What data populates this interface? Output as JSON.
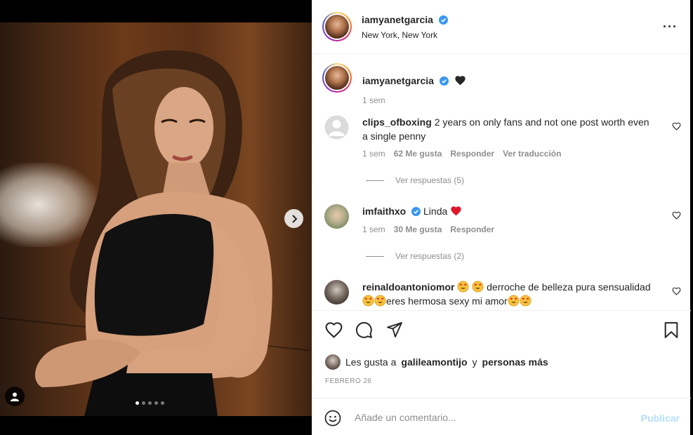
{
  "post": {
    "username": "iamyanetgarcia",
    "location": "New York, New York",
    "caption_emoji": "black-heart",
    "time_ago": "1 sem"
  },
  "media": {
    "total_slides": 5,
    "active_slide": 1
  },
  "comments": [
    {
      "username": "clips_ofboxing",
      "text": "2 years on only fans and not one post worth even a single penny",
      "time": "1 sem",
      "likes": "62 Me gusta",
      "reply": "Responder",
      "translate": "Ver traducción",
      "replies": "Ver respuestas (5)",
      "avatar": "default-avatar-icon"
    },
    {
      "username": "imfaithxo",
      "text": "Linda",
      "time": "1 sem",
      "likes": "30 Me gusta",
      "reply": "Responder",
      "replies": "Ver respuestas (2)",
      "verified": true
    },
    {
      "username": "reinaldoantoniomor",
      "text_a": "derroche de belleza pura",
      "text_b": "sensualidad",
      "text_c": "eres hermosa sexy mi amor"
    }
  ],
  "likes_line": {
    "prefix": "Les gusta a",
    "user": "galileamontijo",
    "middle": "y",
    "suffix": "personas más"
  },
  "date": "FEBRERO 26",
  "comment_input": {
    "placeholder": "Añade un comentario...",
    "submit_label": "Publicar"
  },
  "colors": {
    "verified": "#3897f0",
    "publish_disabled": "#b2dffc",
    "muted_text": "#8e8e8e",
    "heart_red": "#ed4956"
  }
}
